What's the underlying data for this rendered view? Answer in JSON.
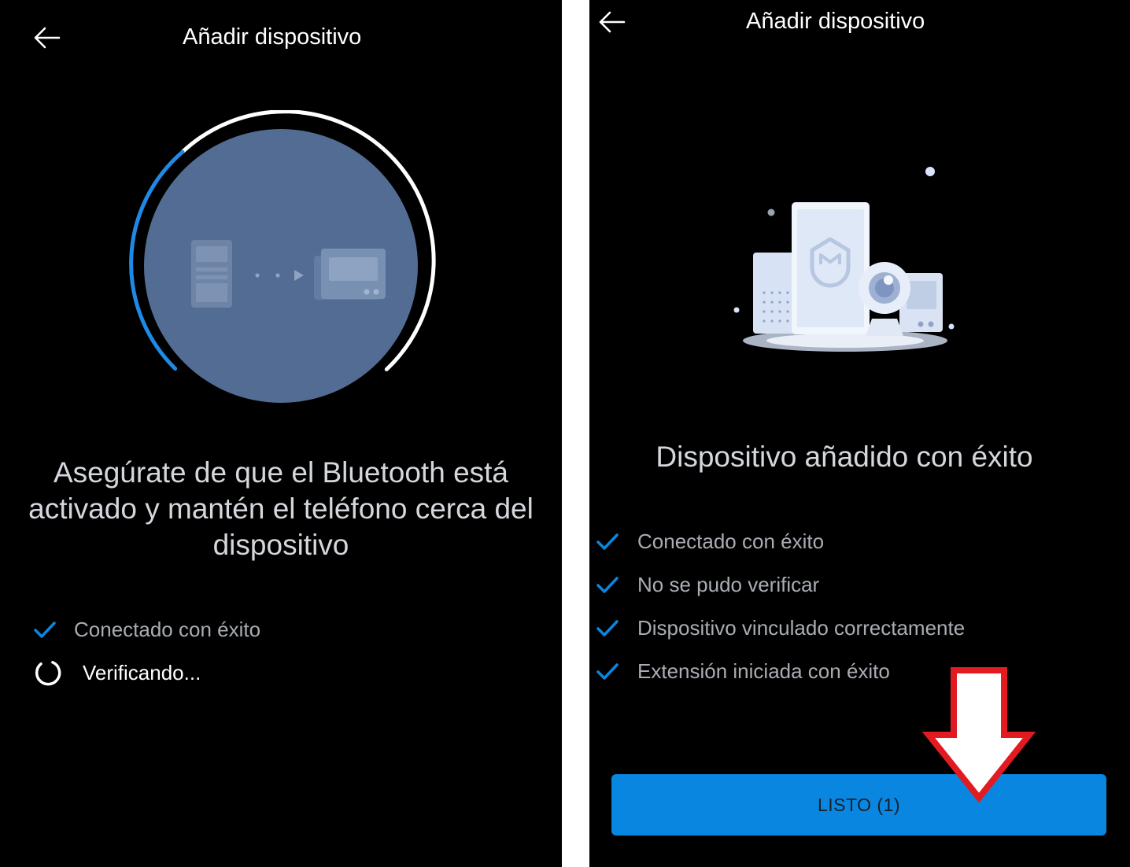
{
  "colors": {
    "accent": "#0986e0",
    "button": "#0986e0",
    "secondary_text": "#a9adb3",
    "callout_arrow": "#e21b22"
  },
  "left_screen": {
    "title": "Añadir dispositivo",
    "back_icon": "arrow-left-icon",
    "message": "Asegúrate de que el Bluetooth está activado y mantén el teléfono cerca del dispositivo",
    "steps": [
      {
        "icon": "check-icon",
        "label": "Conectado con éxito"
      },
      {
        "icon": "spinner-icon",
        "label": "Verificando..."
      }
    ]
  },
  "right_screen": {
    "title": "Añadir dispositivo",
    "back_icon": "arrow-left-icon",
    "headline": "Dispositivo añadido con éxito",
    "steps": [
      {
        "icon": "check-icon",
        "label": "Conectado con éxito"
      },
      {
        "icon": "check-icon",
        "label": "No se pudo verificar"
      },
      {
        "icon": "check-icon",
        "label": "Dispositivo vinculado correctamente"
      },
      {
        "icon": "check-icon",
        "label": "Extensión iniciada con éxito"
      }
    ],
    "done_button": "LISTO (1)"
  }
}
